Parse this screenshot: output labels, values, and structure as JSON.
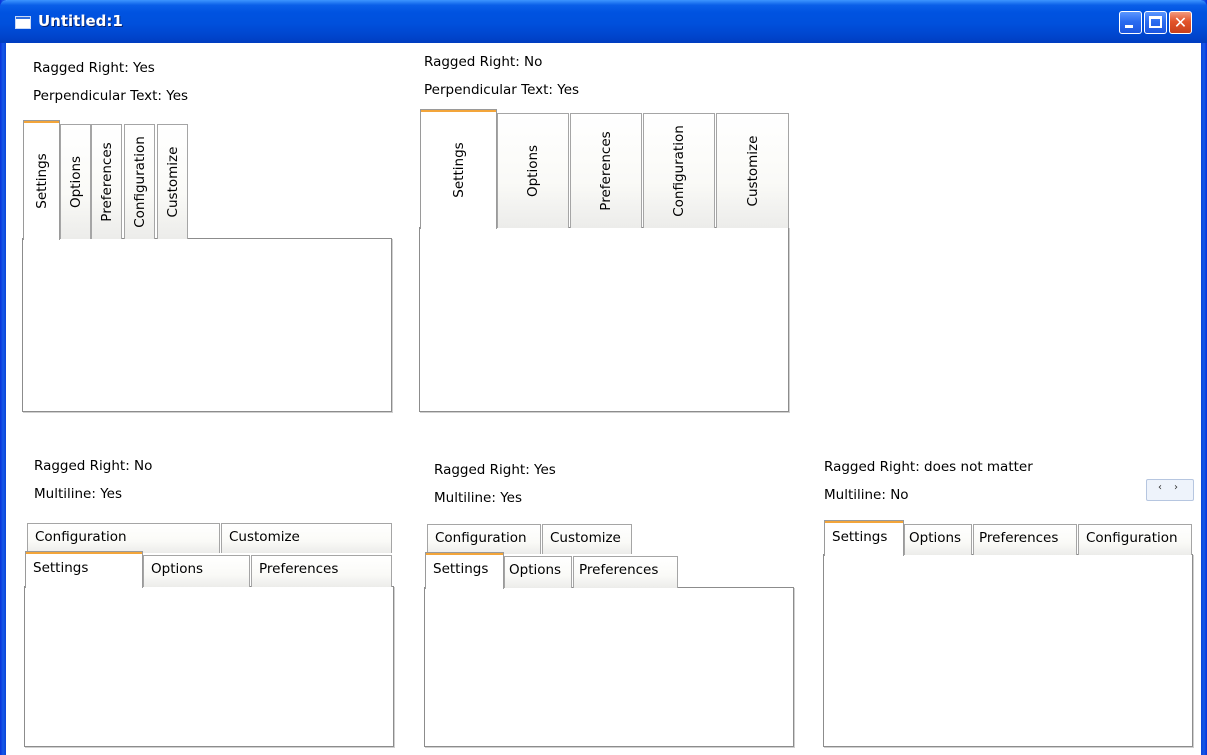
{
  "window": {
    "title": "Untitled:1",
    "close_glyph": "✕"
  },
  "groups": {
    "g1": {
      "line1": "Ragged Right: Yes",
      "line2": "Perpendicular Text: Yes"
    },
    "g2": {
      "line1": "Ragged Right: No",
      "line2": "Perpendicular Text: Yes"
    },
    "g3": {
      "line1": "Ragged Right: No",
      "line2": "Multiline: Yes"
    },
    "g4": {
      "line1": "Ragged Right: Yes",
      "line2": "Multiline: Yes"
    },
    "g5": {
      "line1": "Ragged Right: does not matter",
      "line2": "Multiline: No"
    }
  },
  "tabs": [
    "Settings",
    "Options",
    "Preferences",
    "Configuration",
    "Customize"
  ],
  "selected_tab": "Settings",
  "scroll_arrows": {
    "left": "‹",
    "right": "›"
  },
  "colors": {
    "selected_tab_accent": "#f3a53a",
    "titlebar": "#0053e1"
  }
}
